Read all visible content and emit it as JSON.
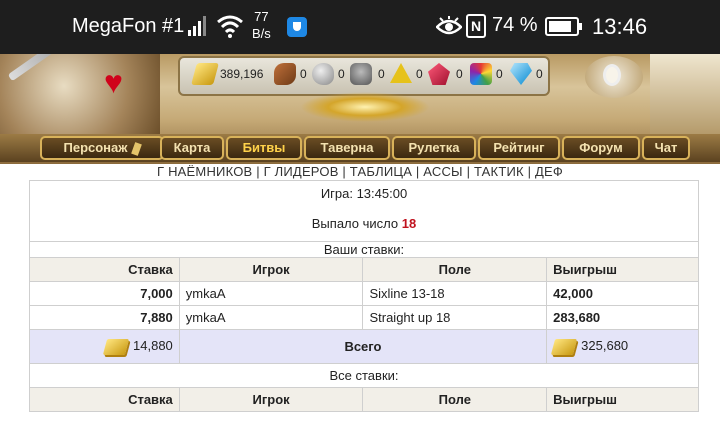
{
  "status_bar": {
    "carrier": "MegaFon #1",
    "net_speed_value": "77",
    "net_speed_unit": "B/s",
    "battery_pct": "74 %",
    "time": "13:46",
    "icons": [
      "signal-icon",
      "wifi-icon",
      "shield-app-icon",
      "eye-icon",
      "nfc-icon",
      "battery-icon"
    ]
  },
  "resources": [
    {
      "icon": "gold-icon",
      "value": "389,196"
    },
    {
      "icon": "wood-icon",
      "value": "0"
    },
    {
      "icon": "stone-icon",
      "value": "0"
    },
    {
      "icon": "iron-icon",
      "value": "0"
    },
    {
      "icon": "sulfur-icon",
      "value": "0"
    },
    {
      "icon": "crystal-icon",
      "value": "0"
    },
    {
      "icon": "gems-icon",
      "value": "0"
    },
    {
      "icon": "diamond-icon",
      "value": "0"
    }
  ],
  "nav": {
    "items": [
      "Персонаж",
      "Карта",
      "Битвы",
      "Таверна",
      "Рулетка",
      "Рейтинг",
      "Форум",
      "Чат"
    ],
    "active": "Битвы"
  },
  "links": [
    "Г НАЁМНИКОВ",
    "Г ЛИДЕРОВ",
    "ТАБЛИЦА",
    "АССЫ",
    "ТАКТИК",
    "ДЕФ"
  ],
  "game": {
    "game_label": "Игра: 13:45:00",
    "result_label": "Выпало число",
    "result_number": "18"
  },
  "your_bets": {
    "title": "Ваши ставки:",
    "headers": [
      "Ставка",
      "Игрок",
      "Поле",
      "Выигрыш"
    ],
    "rows": [
      {
        "bet": "7,000",
        "player": "ymkaA",
        "field": "Sixline 13-18",
        "win": "42,000"
      },
      {
        "bet": "7,880",
        "player": "ymkaA",
        "field": "Straight up 18",
        "win": "283,680"
      }
    ],
    "total_bet": "14,880",
    "total_label": "Всего",
    "total_win": "325,680"
  },
  "all_bets": {
    "title": "Все ставки:",
    "headers": [
      "Ставка",
      "Игрок",
      "Поле",
      "Выигрыш"
    ]
  }
}
